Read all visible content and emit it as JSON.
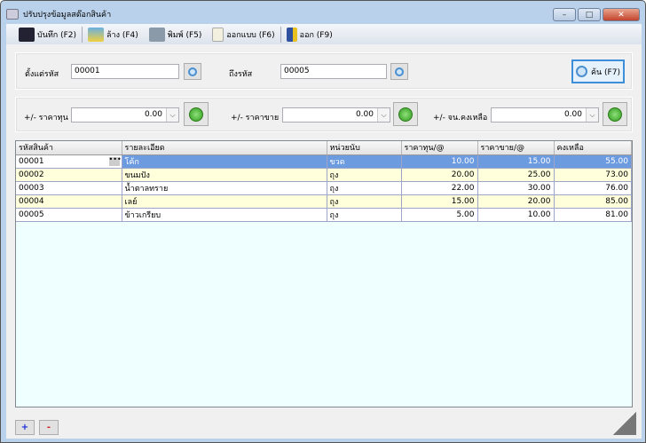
{
  "window": {
    "title": "ปรับปรุงข้อมูลสต๊อกสินค้า",
    "minimize": "–",
    "maximize": "□",
    "close": "✕"
  },
  "toolbar": [
    {
      "label": "บันทึก (F2)",
      "icon": "save-icon"
    },
    {
      "label": "ล้าง (F4)",
      "icon": "clear-icon"
    },
    {
      "label": "พิมพ์ (F5)",
      "icon": "print-icon"
    },
    {
      "label": "ออกแบบ (F6)",
      "icon": "design-icon"
    },
    {
      "label": "ออก (F9)",
      "icon": "exit-icon"
    }
  ],
  "search": {
    "from_label": "ตั้งแต่รหัส",
    "from_value": "00001",
    "to_label": "ถึงรหัส",
    "to_value": "00005",
    "search_button": "ค้น (F7)"
  },
  "adjust": {
    "cost_label": "+/- ราคาทุน",
    "cost_value": "0.00",
    "price_label": "+/- ราคาขาย",
    "price_value": "0.00",
    "qty_label": "+/- จน.คงเหลือ",
    "qty_value": "0.00"
  },
  "grid": {
    "columns": [
      "รหัสสินค้า",
      "รายละเอียด",
      "หน่วยนับ",
      "ราคาทุน/@",
      "ราคาขาย/@",
      "คงเหลือ"
    ],
    "rows": [
      [
        "00001",
        "โค้ก",
        "ขวด",
        "10.00",
        "15.00",
        "55.00"
      ],
      [
        "00002",
        "ขนมปัง",
        "ถุง",
        "20.00",
        "25.00",
        "73.00"
      ],
      [
        "00003",
        "น้ำตาลทราย",
        "ถุง",
        "22.00",
        "30.00",
        "76.00"
      ],
      [
        "00004",
        "เลย์",
        "ถุง",
        "15.00",
        "20.00",
        "85.00"
      ],
      [
        "00005",
        "ข้าวเกรียบ",
        "ถุง",
        "5.00",
        "10.00",
        "81.00"
      ]
    ],
    "ellipsis": "•••"
  },
  "footer": {
    "add": "+",
    "remove": "-"
  }
}
